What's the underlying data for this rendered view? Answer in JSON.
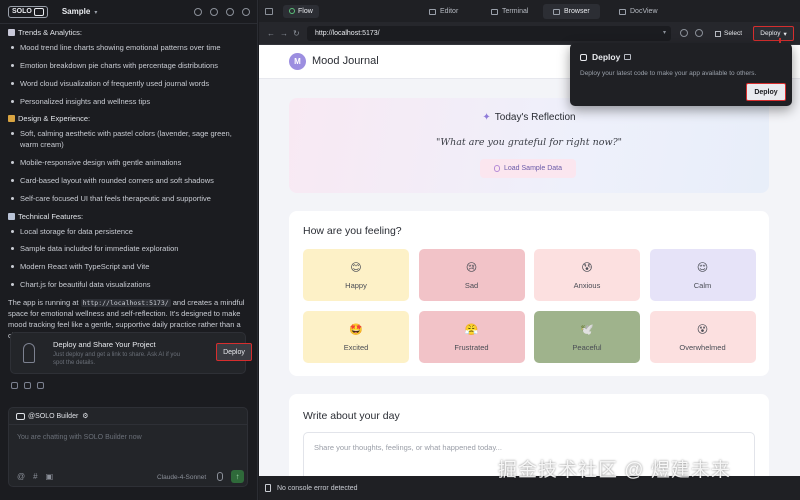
{
  "header": {
    "logo": "SOLO",
    "project": "Sample"
  },
  "chat": {
    "sections": [
      {
        "title": "Trends & Analytics:",
        "icon_color": "#c8c8d8",
        "items": [
          "Mood trend line charts showing emotional patterns over time",
          "Emotion breakdown pie charts with percentage distributions",
          "Word cloud visualization of frequently used journal words",
          "Personalized insights and wellness tips"
        ]
      },
      {
        "title": "Design & Experience:",
        "icon_color": "#d9a441",
        "items": [
          "Soft, calming aesthetic with pastel colors (lavender, sage green, warm cream)",
          "Mobile-responsive design with gentle animations",
          "Card-based layout with rounded corners and soft shadows",
          "Self-care focused UI that feels therapeutic and supportive"
        ]
      },
      {
        "title": "Technical Features:",
        "icon_color": "#b9c3d6",
        "items": [
          "Local storage for data persistence",
          "Sample data included for immediate exploration",
          "Modern React with TypeScript and Vite",
          "Chart.js for beautiful data visualizations"
        ]
      }
    ],
    "para_before": "The app is running at ",
    "para_code": "http://localhost:5173/",
    "para_after": " and creates a mindful space for emotional wellness and self-reflection. It's designed to make mood tracking feel like a gentle, supportive daily practice rather than a chore.",
    "deploy_card": {
      "title": "Deploy and Share Your Project",
      "desc": "Just deploy and get a link to share. Ask AI if you spot the details.",
      "button": "Deploy"
    }
  },
  "composer": {
    "agent": "@SOLO Builder",
    "placeholder": "You are chatting with SOLO Builder now",
    "model": "Claude-4-Sonnet"
  },
  "tabs": {
    "flow": "Flow",
    "editor": "Editor",
    "terminal": "Terminal",
    "browser": "Browser",
    "docview": "DocView"
  },
  "addressbar": {
    "url": "http://localhost:5173/",
    "select": "Select",
    "deploy": "Deploy"
  },
  "popup": {
    "title": "Deploy",
    "desc": "Deploy your latest code to make your app available to others.",
    "button": "Deploy"
  },
  "app": {
    "avatar": "M",
    "title": "Mood Journal",
    "reflection": {
      "title": "Today's Reflection",
      "quote": "\"What are you grateful for right now?\"",
      "button": "Load Sample Data"
    },
    "feelings": {
      "title": "How are you feeling?",
      "moods": [
        {
          "label": "Happy",
          "emoji": "😊",
          "color": "#fdf1c7"
        },
        {
          "label": "Sad",
          "emoji": "😢",
          "color": "#f2c3c8"
        },
        {
          "label": "Anxious",
          "emoji": "😰",
          "color": "#fce0e0"
        },
        {
          "label": "Calm",
          "emoji": "😌",
          "color": "#e6e3f8"
        },
        {
          "label": "Excited",
          "emoji": "🤩",
          "color": "#fdf1c7"
        },
        {
          "label": "Frustrated",
          "emoji": "😤",
          "color": "#f2c3c8"
        },
        {
          "label": "Peaceful",
          "emoji": "🕊️",
          "color": "#9fb38c"
        },
        {
          "label": "Overwhelmed",
          "emoji": "😵",
          "color": "#fce0e0"
        }
      ]
    },
    "write": {
      "title": "Write about your day",
      "placeholder": "Share your thoughts, feelings, or what happened today..."
    }
  },
  "console": "No console error detected",
  "watermark": "掘金技术社区 @ 煜建未来"
}
